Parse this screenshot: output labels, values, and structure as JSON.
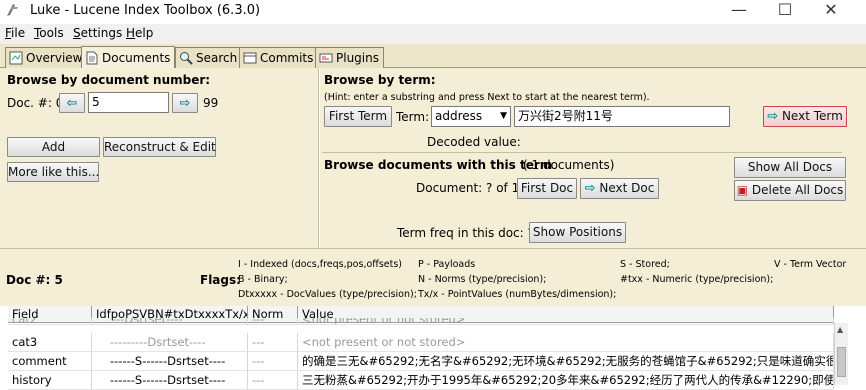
{
  "window": {
    "title": "Luke - Lucene Index Toolbox (6.3.0)",
    "minimize": "—",
    "maximize": "☐",
    "close": "✕"
  },
  "menu": [
    {
      "key": "F",
      "rest": "ile"
    },
    {
      "key": "T",
      "rest": "ools"
    },
    {
      "key": "S",
      "rest": "ettings"
    },
    {
      "key": "H",
      "rest": "elp"
    }
  ],
  "tabs": [
    "Overview",
    "Documents",
    "Search",
    "Commits",
    "Plugins"
  ],
  "left": {
    "heading": "Browse by document number:",
    "doc_label": "Doc. #: 0",
    "doc_value": "5",
    "max_doc": "99",
    "add": "Add",
    "reconstruct": "Reconstruct & Edit",
    "more_like": "More like this..."
  },
  "right": {
    "heading": "Browse by term:",
    "hint": "(Hint: enter a substring and press Next to start at the nearest term).",
    "first_term": "First Term",
    "term_label": "Term:",
    "field_value": "address",
    "term_value": "万兴街2号附11号",
    "next_term": "Next Term",
    "decoded_label": "Decoded value:",
    "browse_docs_heading": "Browse documents with this term",
    "docs_count": "( 1 documents)",
    "document_label": "Document: ? of 1",
    "first_doc": "First Doc",
    "next_doc": "Next Doc",
    "show_all_docs": "Show All Docs",
    "delete_all_docs": "Delete All Docs",
    "term_freq": "Term freq in this doc: ?",
    "show_positions": "Show Positions"
  },
  "info": {
    "doc_num": "Doc #: 5",
    "flags_label": "Flags:",
    "legend": {
      "indexed": "I - Indexed (docs,freqs,pos,offsets)",
      "payloads": "P - Payloads",
      "stored": "S - Stored;",
      "term_vector": "V - Term Vector",
      "binary": "B - Binary;",
      "norms": "N - Norms (type/precision);",
      "numeric": "#txx - Numeric (type/precision);",
      "docvalues": "Dtxxxxx - DocValues (type/precision);",
      "pointvalues": "Tx/x - PointValues (numBytes/dimension);"
    }
  },
  "table": {
    "headers": [
      "Field",
      "IdfpoPSVBN#txDtxxxxTx/x",
      "Norm",
      "Value"
    ],
    "rows": [
      {
        "field": "cat2",
        "flags": "---Dsrtset----",
        "norm": "---",
        "value": "<not present or not stored>",
        "partial": true
      },
      {
        "field": "cat3",
        "flags": "---------Dsrtset----",
        "norm": "---",
        "value": "<not present or not stored>",
        "grey": true
      },
      {
        "field": "comment",
        "flags": "------S------Dsrtset----",
        "norm": "---",
        "value": "的确是三无&#65292;无名字&#65292;无环境&#65292;无服务的苍蝇馆子&#65292;只是味道确实很"
      },
      {
        "field": "history",
        "flags": "------S------Dsrtset----",
        "norm": "---",
        "value": "三无粉蒸&#65292;开办于1995年&#65292;20多年来&#65292;经历了两代人的传承&#12290;即使"
      }
    ]
  }
}
